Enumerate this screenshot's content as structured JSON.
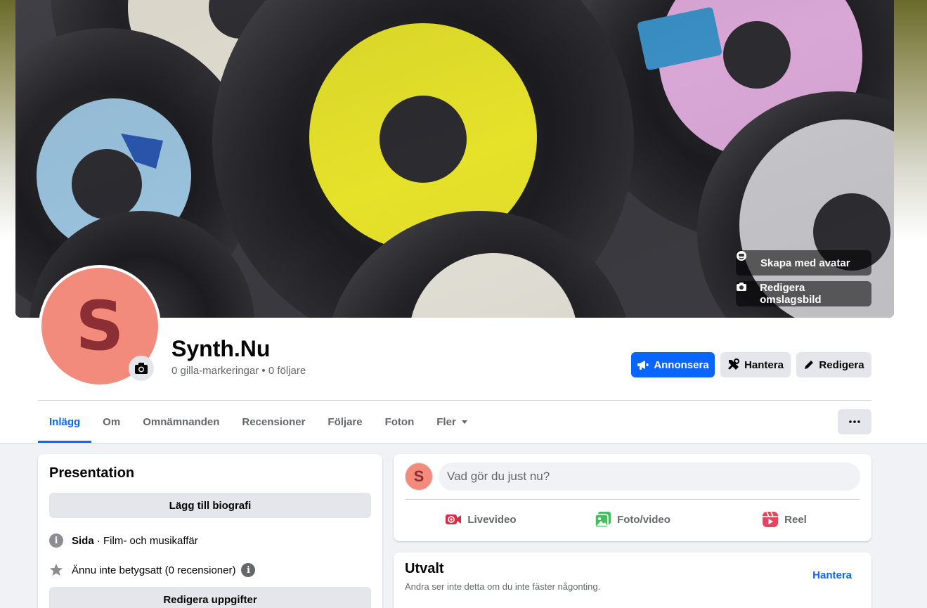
{
  "cover": {
    "avatar_button": "Skapa med avatar",
    "edit_cover_button": "Redigera omslagsbild"
  },
  "profile": {
    "initial": "S",
    "name": "Synth.Nu",
    "likes": "0 gilla-markeringar",
    "separator": " • ",
    "followers": "0 följare"
  },
  "actions": {
    "advertise": "Annonsera",
    "manage": "Hantera",
    "edit": "Redigera"
  },
  "tabs": [
    {
      "label": "Inlägg"
    },
    {
      "label": "Om"
    },
    {
      "label": "Omnämnanden"
    },
    {
      "label": "Recensioner"
    },
    {
      "label": "Följare"
    },
    {
      "label": "Foton"
    },
    {
      "label": "Fler"
    }
  ],
  "intro": {
    "title": "Presentation",
    "add_bio": "Lägg till biografi",
    "page_label": "Sida",
    "page_category": " · Film- och musikaffär",
    "rating": "Ännu inte betygsatt (0 recensioner)",
    "edit_details": "Redigera uppgifter"
  },
  "composer": {
    "initial": "S",
    "placeholder": "Vad gör du just nu?",
    "live": "Livevideo",
    "photo": "Foto/video",
    "reel": "Reel"
  },
  "featured": {
    "title": "Utvalt",
    "subtitle": "Andra ser inte detta om du inte fäster någonting.",
    "manage": "Hantera"
  },
  "colors": {
    "accent": "#0866ff",
    "avatar_bg": "#f28b7c",
    "avatar_fg": "#8c2f34",
    "live_red": "#e42645",
    "photo_green": "#45bd62",
    "reel_pink": "#e3465f"
  }
}
